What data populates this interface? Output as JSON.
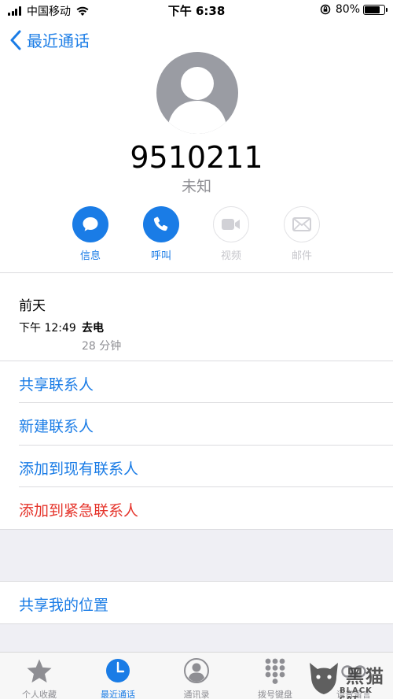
{
  "status_bar": {
    "carrier": "中国移动",
    "time": "下午 6:38",
    "battery": "80%",
    "battery_level": 0.8
  },
  "nav": {
    "back_label": "最近通话"
  },
  "contact": {
    "number": "9510211",
    "label": "未知"
  },
  "actions": [
    {
      "label": "信息",
      "icon": "message-icon",
      "enabled": true
    },
    {
      "label": "呼叫",
      "icon": "phone-icon",
      "enabled": true
    },
    {
      "label": "视频",
      "icon": "video-icon",
      "enabled": false
    },
    {
      "label": "邮件",
      "icon": "mail-icon",
      "enabled": false
    }
  ],
  "recent_call": {
    "day": "前天",
    "time": "下午 12:49",
    "type": "去电",
    "duration": "28 分钟"
  },
  "menu": {
    "share_contact": "共享联系人",
    "new_contact": "新建联系人",
    "add_existing": "添加到现有联系人",
    "add_emergency": "添加到紧急联系人",
    "share_location": "共享我的位置"
  },
  "tabbar": [
    {
      "label": "个人收藏",
      "icon": "star-icon",
      "active": false
    },
    {
      "label": "最近通话",
      "icon": "clock-icon",
      "active": true
    },
    {
      "label": "通讯录",
      "icon": "contacts-icon",
      "active": false
    },
    {
      "label": "拨号键盘",
      "icon": "keypad-icon",
      "active": false
    },
    {
      "label": "语音留言",
      "icon": "voicemail-icon",
      "active": false
    }
  ],
  "watermark": {
    "text": "黑猫",
    "sub": "BLACK CAT"
  },
  "colors": {
    "accent": "#1a7ce6",
    "danger": "#e5342b",
    "secondary_text": "#8e8e93"
  }
}
